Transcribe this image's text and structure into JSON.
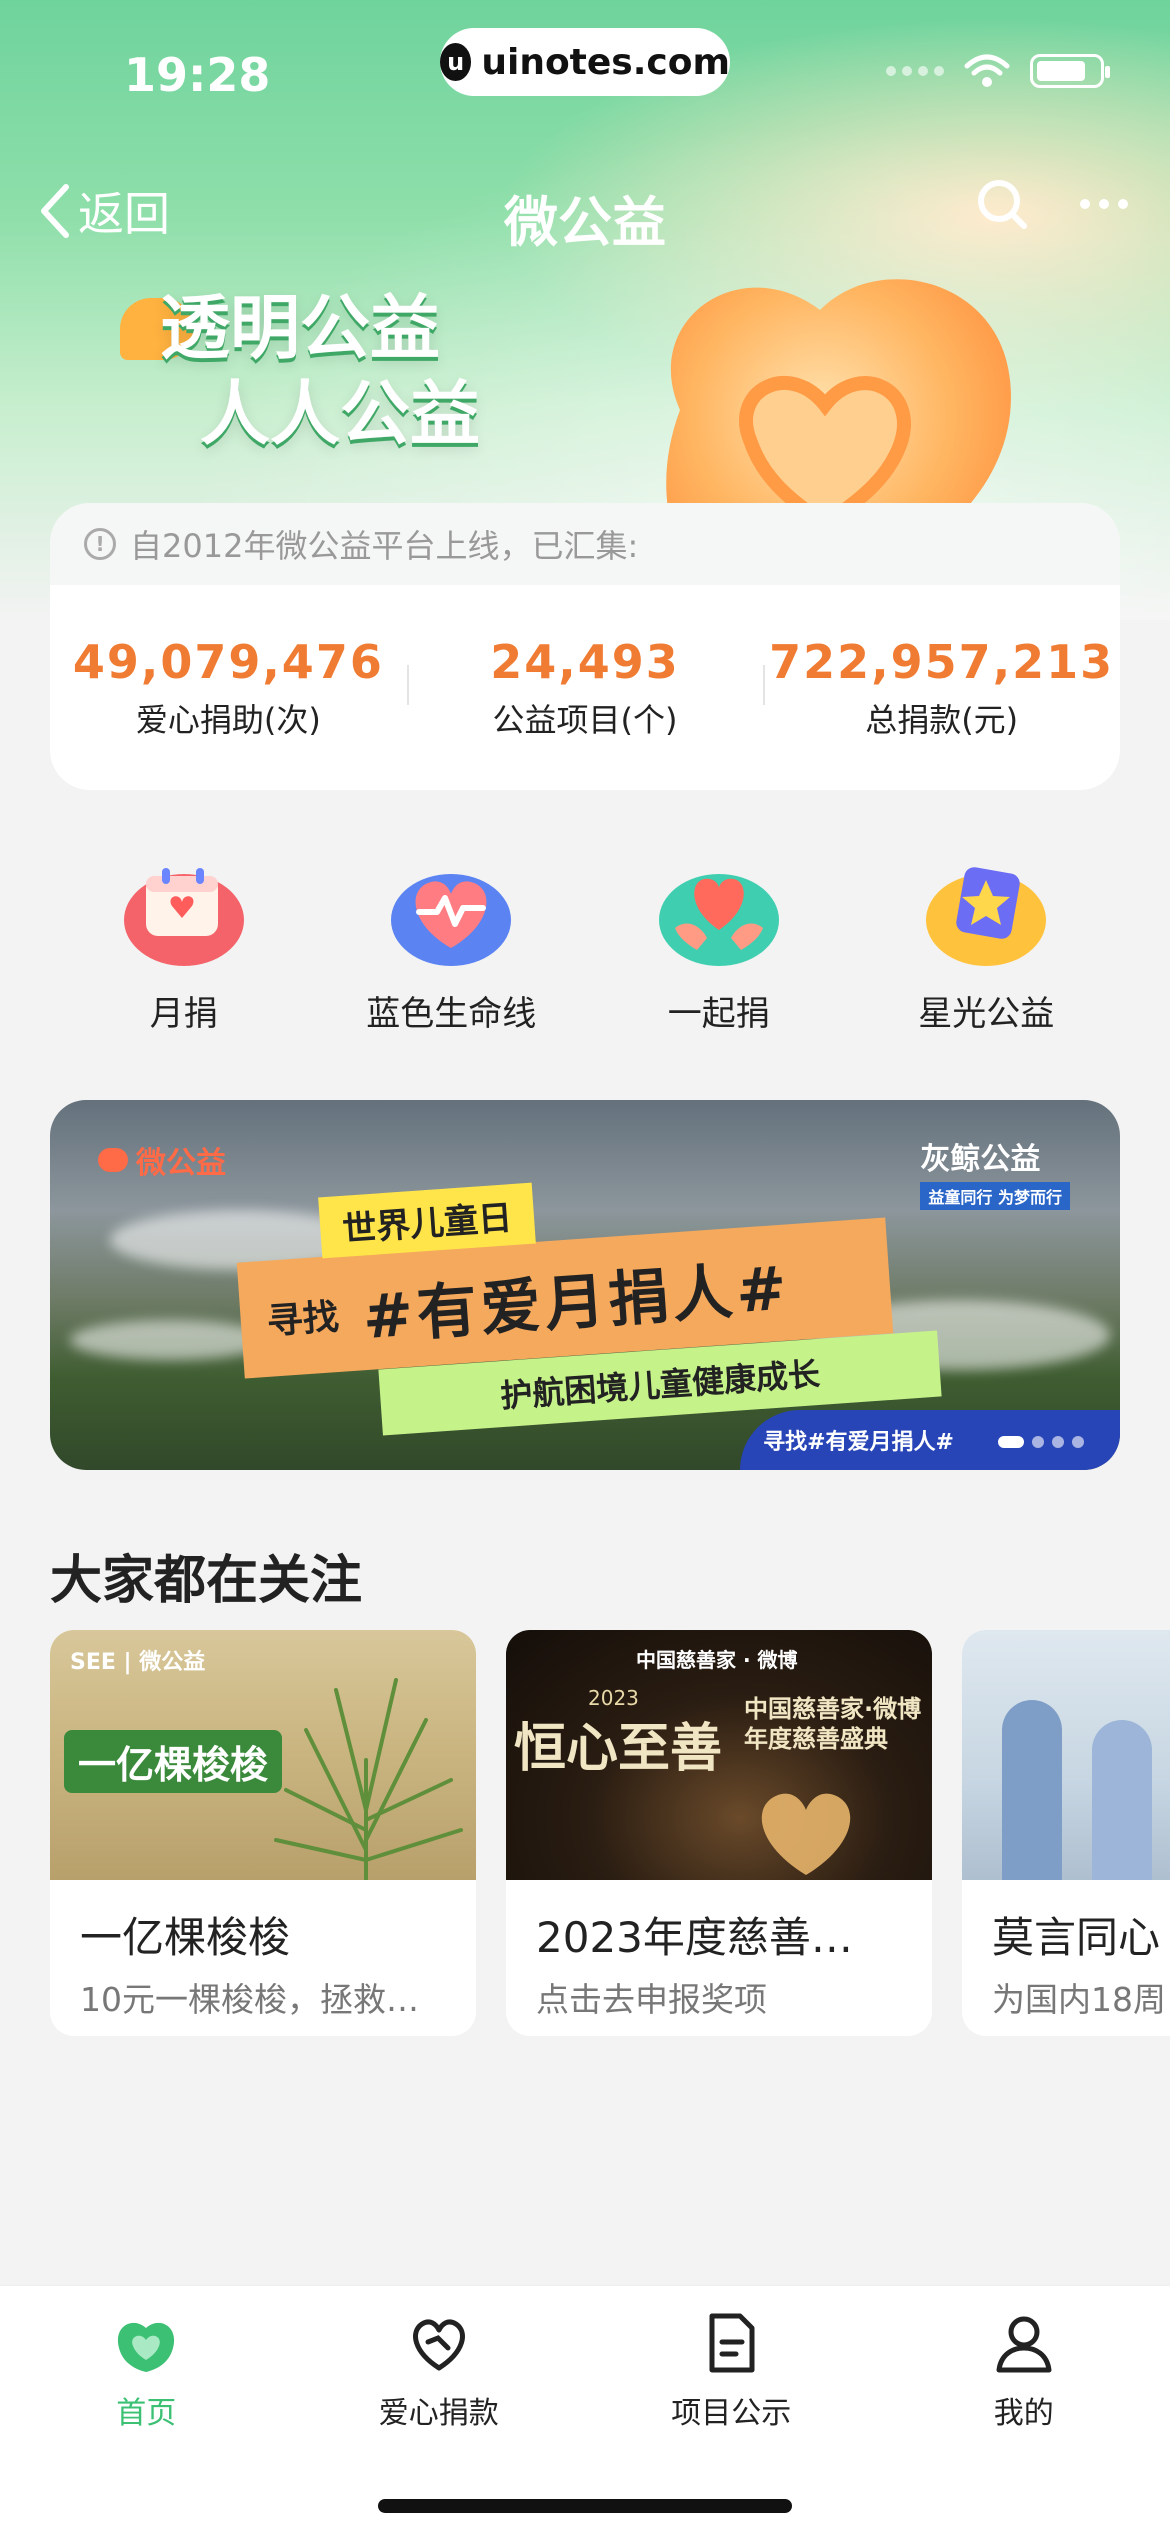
{
  "status_bar": {
    "time": "19:28",
    "url": "uinotes.com"
  },
  "nav": {
    "back_label": "返回",
    "title": "微公益"
  },
  "hero": {
    "slogan_line1": "透明公益",
    "slogan_line2": "人人公益"
  },
  "stats": {
    "header": "自2012年微公益平台上线，已汇集:",
    "items": [
      {
        "value": "49,079,476",
        "label": "爱心捐助(次)"
      },
      {
        "value": "24,493",
        "label": "公益项目(个)"
      },
      {
        "value": "722,957,213",
        "label": "总捐款(元)"
      }
    ]
  },
  "entries": [
    {
      "label": "月捐",
      "icon": "calendar-heart-icon"
    },
    {
      "label": "蓝色生命线",
      "icon": "heartbeat-icon"
    },
    {
      "label": "一起捐",
      "icon": "hands-heart-icon"
    },
    {
      "label": "星光公益",
      "icon": "star-badge-icon"
    }
  ],
  "banner": {
    "brand_left": "微公益",
    "brand_right": "灰鲸公益",
    "brand_right_sub": "益童同行 为梦而行",
    "tag_small": "世界儿童日",
    "tag_prefix": "寻找",
    "tag_main": "#有爱月捐人#",
    "tag_sub": "护航困境儿童健康成长",
    "corner_text": "寻找#有爱月捐人#"
  },
  "section": {
    "title": "大家都在关注",
    "cards": [
      {
        "title": "一亿棵梭梭",
        "subtitle": "10元一棵梭梭，拯救…",
        "image_text": "一亿棵梭梭",
        "image_brand": "SEE | 微公益"
      },
      {
        "title": "2023年度慈善…",
        "subtitle": "点击去申报奖项",
        "image_text": "恒心至善",
        "image_year": "2023",
        "image_brand": "中国慈善家 · 微博",
        "image_caption": "中国慈善家·微博 年度慈善盛典"
      },
      {
        "title": "莫言同心",
        "subtitle": "为国内18周"
      }
    ]
  },
  "tabbar": {
    "tabs": [
      {
        "label": "首页",
        "active": true
      },
      {
        "label": "爱心捐款",
        "active": false
      },
      {
        "label": "项目公示",
        "active": false
      },
      {
        "label": "我的",
        "active": false
      }
    ],
    "accent": "#3cc074"
  },
  "colors": {
    "stat_value": "#f07b32",
    "brand_green": "#3cc074"
  }
}
